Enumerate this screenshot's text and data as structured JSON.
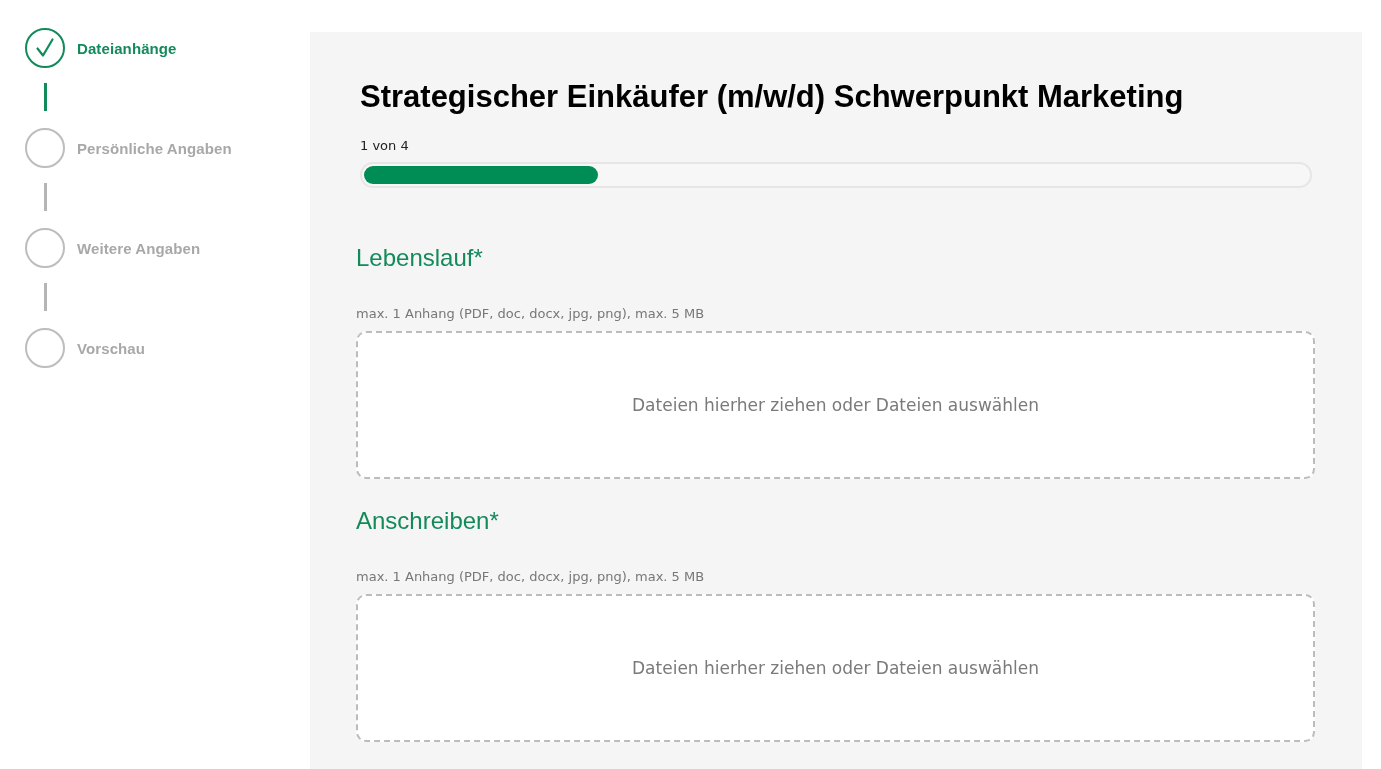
{
  "steps": [
    {
      "label": "Dateianhänge",
      "done": true
    },
    {
      "label": "Persönliche Angaben",
      "done": false
    },
    {
      "label": "Weitere Angaben",
      "done": false
    },
    {
      "label": "Vorschau",
      "done": false
    }
  ],
  "job_title": "Strategischer Einkäufer (m/w/d) Schwerpunkt Marketing",
  "progress": {
    "label": "1 von 4",
    "level": 0.25
  },
  "uploads": [
    {
      "heading": "Lebenslauf*",
      "hint": "max. 1 Anhang (PDF, doc, docx, jpg, png), max. 5 MB",
      "dropzone_text": "Dateien hierher ziehen oder Dateien auswählen"
    },
    {
      "heading": "Anschreiben*",
      "hint": "max. 1 Anhang (PDF, doc, docx, jpg, png), max. 5 MB",
      "dropzone_text": "Dateien hierher ziehen oder Dateien auswählen"
    }
  ]
}
